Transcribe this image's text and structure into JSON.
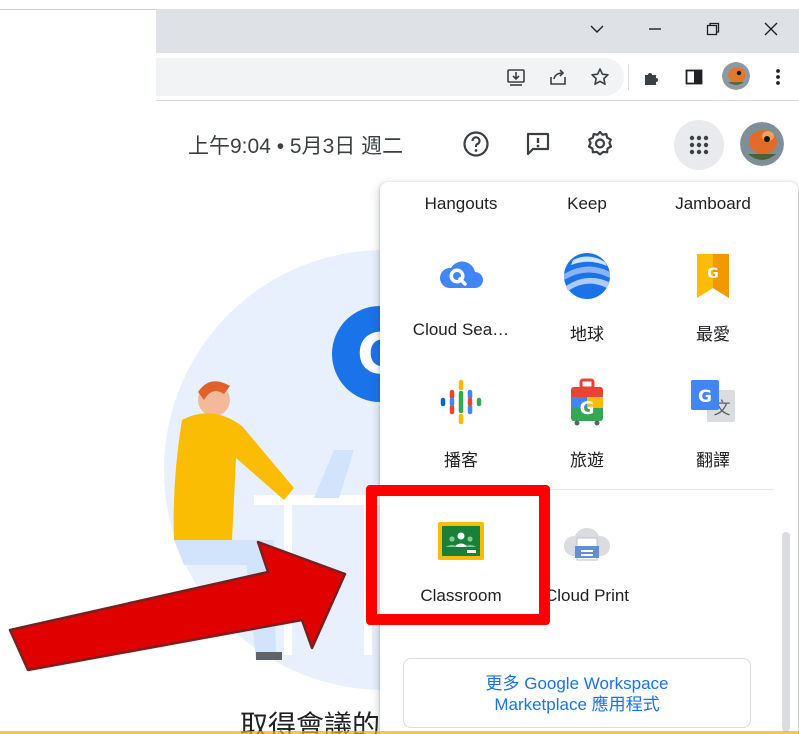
{
  "browser": {
    "window_controls": [
      "chevron-down",
      "minimize",
      "restore",
      "close"
    ],
    "toolbar_icons": [
      "install-icon",
      "share-icon",
      "bookmark-star-icon",
      "extensions-puzzle-icon",
      "side-panel-icon",
      "profile-avatar",
      "more-vert-icon"
    ]
  },
  "header": {
    "datetime": "上午9:04 • 5月3日 週二",
    "icons": [
      "help-icon",
      "feedback-icon",
      "settings-icon",
      "apps-grid-icon",
      "account-avatar"
    ]
  },
  "apps_panel": {
    "top_row": [
      {
        "label": "Hangouts"
      },
      {
        "label": "Keep"
      },
      {
        "label": "Jamboard"
      }
    ],
    "row2": [
      {
        "label": "Cloud Sea…",
        "icon": "cloud-search-icon"
      },
      {
        "label": "地球",
        "icon": "earth-icon"
      },
      {
        "label": "最愛",
        "icon": "saved-bookmark-icon"
      }
    ],
    "row3": [
      {
        "label": "播客",
        "icon": "podcasts-icon"
      },
      {
        "label": "旅遊",
        "icon": "travel-icon"
      },
      {
        "label": "翻譯",
        "icon": "translate-icon"
      }
    ],
    "row4": [
      {
        "label": "Classroom",
        "icon": "classroom-icon"
      },
      {
        "label": "Cloud Print",
        "icon": "cloud-print-icon"
      }
    ],
    "more_line1": "更多 Google Workspace",
    "more_line2": "Marketplace 應用程式"
  },
  "background": {
    "heading_partial": "取得會議的"
  },
  "colors": {
    "accent": "#1a73e8",
    "annotation": "#ff0000",
    "panel_bg": "#ffffff",
    "chrome_bg": "#dee1e6"
  }
}
